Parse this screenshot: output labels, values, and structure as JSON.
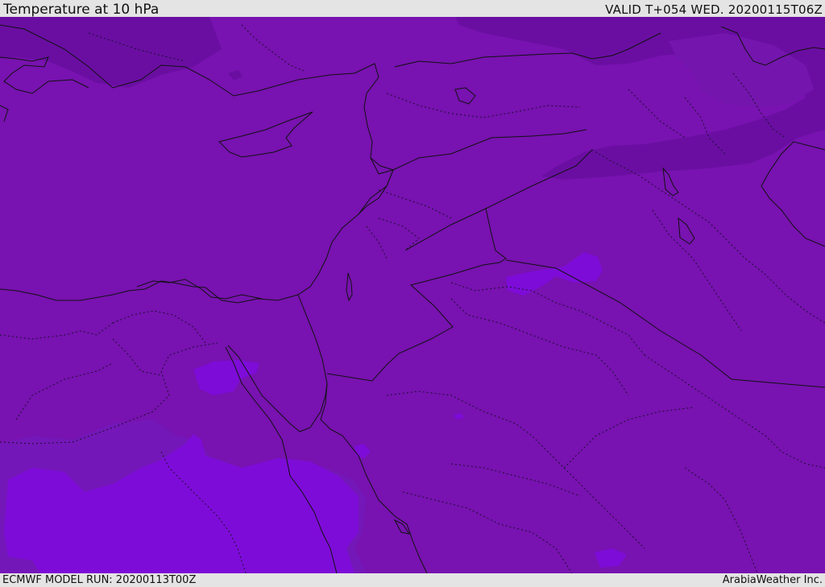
{
  "header": {
    "title": "Temperature at 10 hPa",
    "valid": "VALID T+054 WED. 20200115T06Z"
  },
  "footer": {
    "model_run": "ECMWF MODEL RUN: 20200113T00Z",
    "brand": "ArabiaWeather Inc."
  },
  "colors": {
    "base_field": "#7812b0",
    "cold_band": "#6a0ea2",
    "mid_field": "#7417b8",
    "warm_patch": "#7e0cd8"
  }
}
